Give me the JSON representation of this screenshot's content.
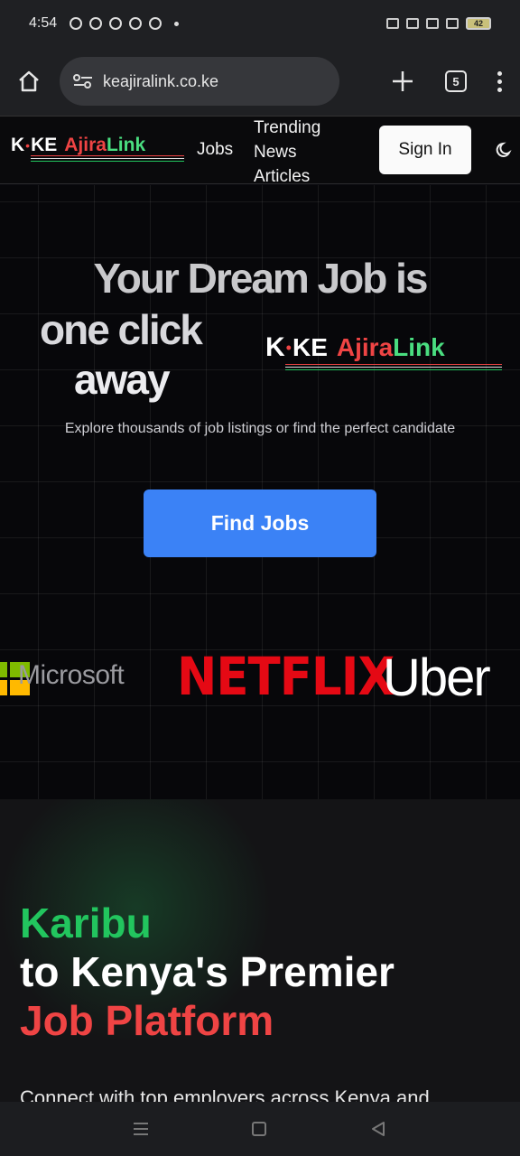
{
  "status_bar": {
    "time": "4:54",
    "battery": "42"
  },
  "browser": {
    "url": "keajiralink.co.ke",
    "tab_count": "5"
  },
  "logo": {
    "k": "K",
    "ke": "KE",
    "ajira": "Ajira",
    "link": "Link"
  },
  "nav": {
    "jobs": "Jobs",
    "trending_line1": "Trending",
    "trending_line2": "News",
    "trending_line3": "Articles",
    "sign_in": "Sign In"
  },
  "hero": {
    "title_line1": "Your Dream Job is",
    "title_line2": "one click",
    "title_line3": "away",
    "subtitle": "Explore thousands of job listings or find the perfect candidate",
    "cta": "Find Jobs",
    "partners": [
      "Microsoft",
      "NETFLIX",
      "Uber"
    ]
  },
  "karibu": {
    "line1": "Karibu",
    "line2": "to Kenya's Premier",
    "line3": "Job Platform",
    "line4": "Connect with top employers across Kenya and"
  },
  "colors": {
    "accent_blue": "#3b82f6",
    "kenya_green": "#22c55e",
    "kenya_red": "#ef4444",
    "netflix_red": "#e50914"
  }
}
